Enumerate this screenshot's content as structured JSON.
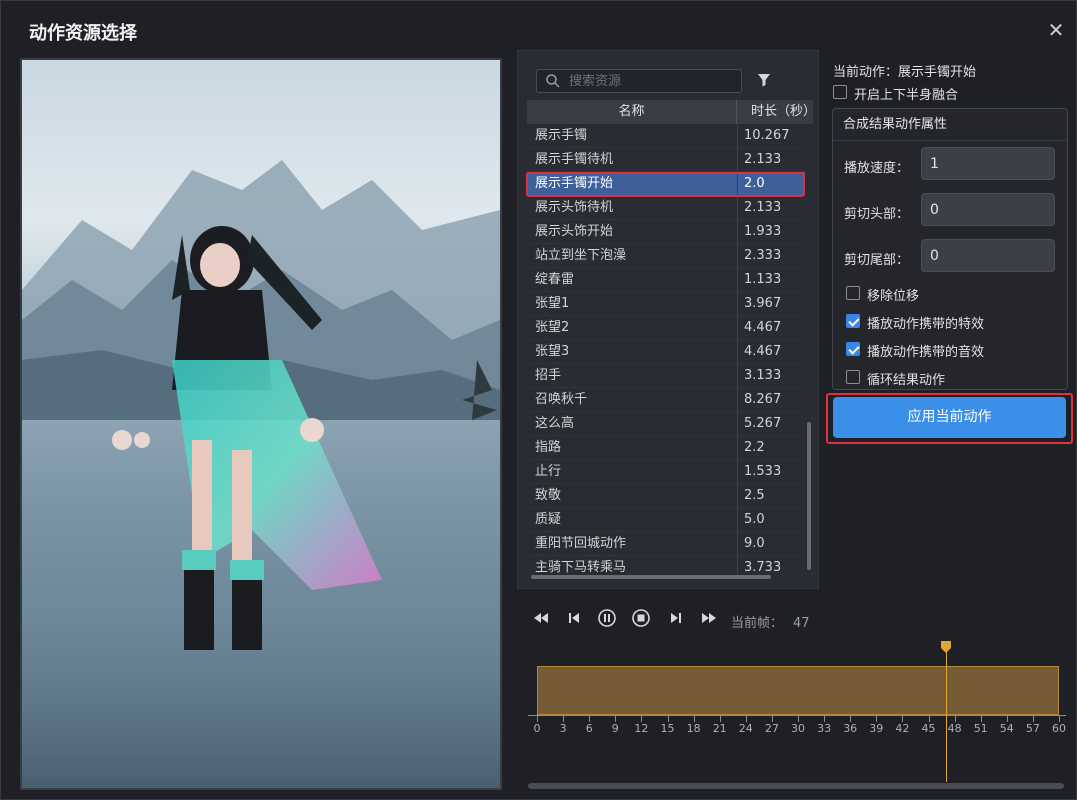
{
  "window": {
    "title": "动作资源选择",
    "close_icon": "close-icon"
  },
  "search": {
    "placeholder": "搜索资源",
    "value": ""
  },
  "table": {
    "col_name": "名称",
    "col_duration": "时长（秒）",
    "rows": [
      {
        "name": "展示手镯",
        "duration": "10.267"
      },
      {
        "name": "展示手镯待机",
        "duration": "2.133"
      },
      {
        "name": "展示手镯开始",
        "duration": "2.0"
      },
      {
        "name": "展示头饰待机",
        "duration": "2.133"
      },
      {
        "name": "展示头饰开始",
        "duration": "1.933"
      },
      {
        "name": "站立到坐下泡澡",
        "duration": "2.333"
      },
      {
        "name": "绽春雷",
        "duration": "1.133"
      },
      {
        "name": "张望1",
        "duration": "3.967"
      },
      {
        "name": "张望2",
        "duration": "4.467"
      },
      {
        "name": "张望3",
        "duration": "4.467"
      },
      {
        "name": "招手",
        "duration": "3.133"
      },
      {
        "name": "召唤秋千",
        "duration": "8.267"
      },
      {
        "name": "这么高",
        "duration": "5.267"
      },
      {
        "name": "指路",
        "duration": "2.2"
      },
      {
        "name": "止行",
        "duration": "1.533"
      },
      {
        "name": "致敬",
        "duration": "2.5"
      },
      {
        "name": "质疑",
        "duration": "5.0"
      },
      {
        "name": "重阳节回城动作",
        "duration": "9.0"
      },
      {
        "name": "主骑下马转乘马",
        "duration": "3.733"
      }
    ],
    "selected_index": 2
  },
  "right": {
    "current_action": "当前动作：展示手镯开始",
    "blend_label": "开启上下半身融合",
    "blend_checked": false,
    "group_title": "合成结果动作属性",
    "speed_label": "播放速度：",
    "speed_value": "1",
    "trim_head_label": "剪切头部：",
    "trim_head_value": "0",
    "trim_tail_label": "剪切尾部：",
    "trim_tail_value": "0",
    "remove_disp_label": "移除位移",
    "remove_disp_checked": false,
    "play_fx_label": "播放动作携带的特效",
    "play_fx_checked": true,
    "play_sfx_label": "播放动作携带的音效",
    "play_sfx_checked": true,
    "loop_label": "循环结果动作",
    "loop_checked": false,
    "apply_label": "应用当前动作"
  },
  "transport": {
    "frame_label": "当前帧：",
    "frame_value": "47"
  },
  "timeline": {
    "ticks": [
      "0",
      "3",
      "6",
      "9",
      "12",
      "15",
      "18",
      "21",
      "24",
      "27",
      "30",
      "33",
      "36",
      "39",
      "42",
      "45",
      "48",
      "51",
      "54",
      "57",
      "60"
    ],
    "playhead_frame": 47,
    "accent": "#e0a630"
  },
  "colors": {
    "accent": "#3b8fe8",
    "highlight": "#e0303f",
    "selected_row": "#3f5f9a"
  }
}
